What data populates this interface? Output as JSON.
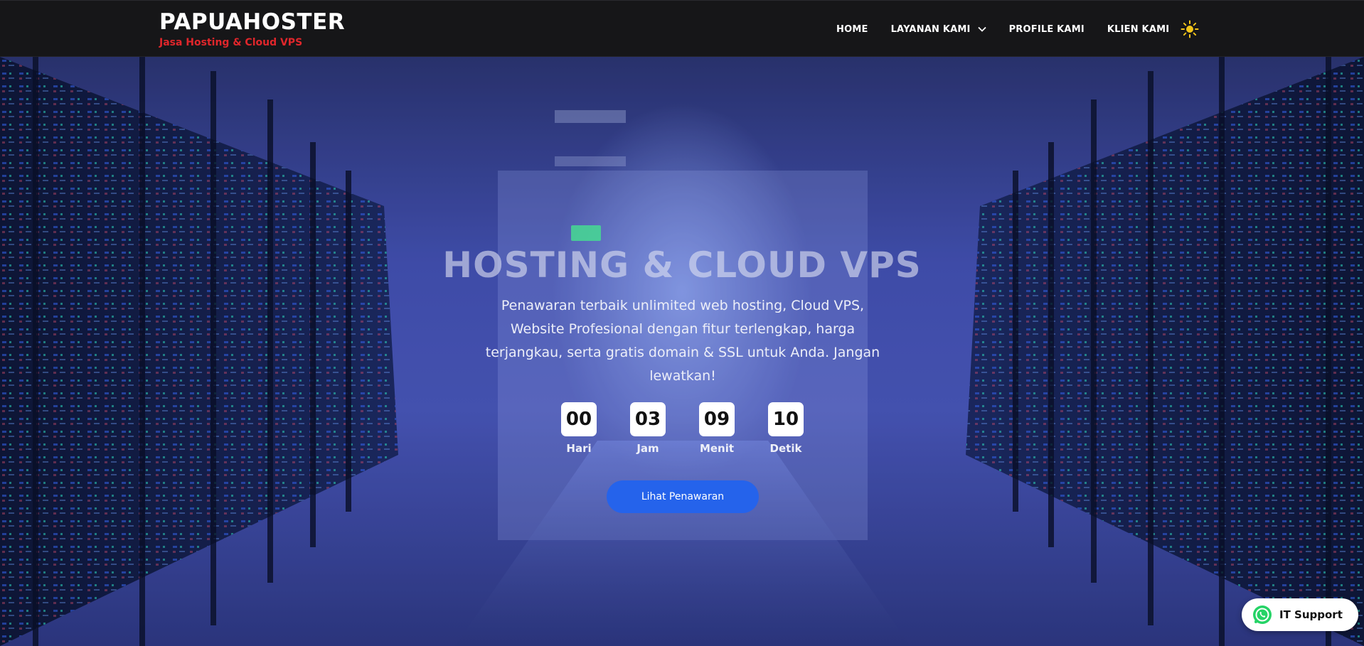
{
  "brand": {
    "title": "PAPUAHOSTER",
    "tagline": "Jasa Hosting & Cloud VPS"
  },
  "nav": {
    "items": [
      {
        "label": "HOME"
      },
      {
        "label": "LAYANAN KAMI",
        "has_dropdown": true
      },
      {
        "label": "PROFILE KAMI"
      },
      {
        "label": "KLIEN KAMI"
      }
    ],
    "theme_toggle_icon": "sun-icon"
  },
  "hero": {
    "title": "HOSTING & CLOUD VPS",
    "subtitle": "Penawaran terbaik unlimited web hosting, Cloud VPS, Website Profesional dengan fitur terlengkap, harga terjangkau, serta gratis domain & SSL untuk Anda. Jangan lewatkan!",
    "countdown": [
      {
        "value": "00",
        "label": "Hari"
      },
      {
        "value": "03",
        "label": "Jam"
      },
      {
        "value": "09",
        "label": "Menit"
      },
      {
        "value": "10",
        "label": "Detik"
      }
    ],
    "cta_label": "Lihat Penawaran"
  },
  "support": {
    "label": "IT Support",
    "icon": "whatsapp-icon"
  },
  "colors": {
    "navbar_bg": "#161618",
    "tagline": "#e0262b",
    "cta": "#2563eb",
    "whatsapp": "#25d366"
  }
}
